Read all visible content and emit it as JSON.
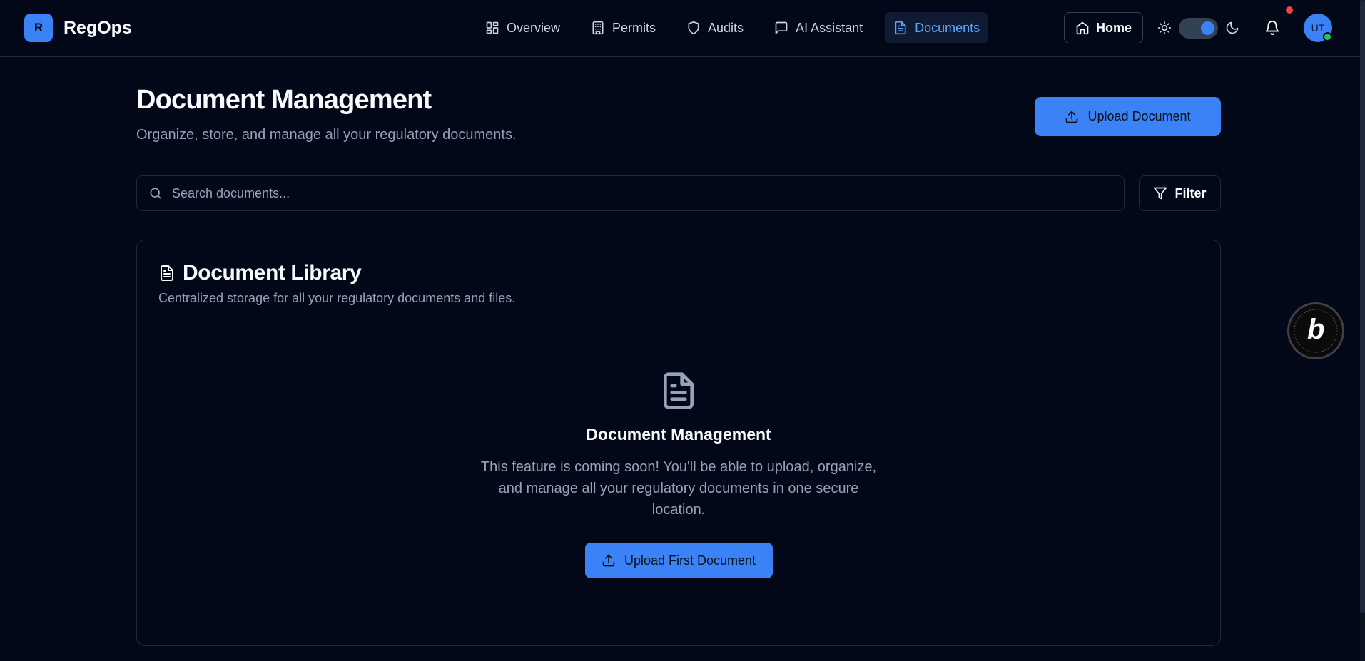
{
  "brand": {
    "logo_letter": "R",
    "name": "RegOps"
  },
  "nav": {
    "items": [
      {
        "label": "Overview",
        "icon": "layout-dashboard-icon"
      },
      {
        "label": "Permits",
        "icon": "building-icon"
      },
      {
        "label": "Audits",
        "icon": "shield-icon"
      },
      {
        "label": "AI Assistant",
        "icon": "message-square-icon"
      },
      {
        "label": "Documents",
        "icon": "file-text-icon",
        "active": true
      }
    ],
    "home_label": "Home"
  },
  "user": {
    "initials": "UT"
  },
  "header": {
    "title": "Document Management",
    "subtitle": "Organize, store, and manage all your regulatory documents.",
    "upload_label": "Upload Document"
  },
  "search": {
    "placeholder": "Search documents...",
    "value": ""
  },
  "filter_label": "Filter",
  "library": {
    "title": "Document Library",
    "description": "Centralized storage for all your regulatory documents and files.",
    "empty_title": "Document Management",
    "empty_text": "This feature is coming soon! You'll be able to upload, organize, and manage all your regulatory documents in one secure location.",
    "empty_button": "Upload First Document"
  },
  "colors": {
    "background": "#020817",
    "accent": "#3b82f6",
    "muted_text": "#94a3b8",
    "border": "#1e293b"
  }
}
